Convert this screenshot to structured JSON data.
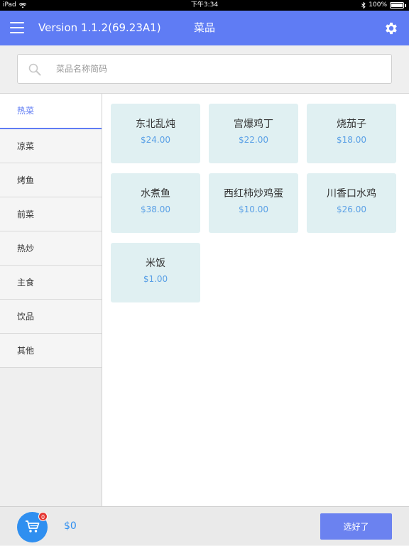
{
  "statusbar": {
    "device": "iPad",
    "time": "下午3:34",
    "battery": "100%"
  },
  "header": {
    "version": "Version 1.1.2(69.23A1)",
    "title": "菜品",
    "menu_icon": "hamburger-menu-icon",
    "settings_icon": "gear-icon"
  },
  "search": {
    "placeholder": "菜品名称简码",
    "value": ""
  },
  "categories": [
    {
      "label": "热菜",
      "active": true
    },
    {
      "label": "凉菜"
    },
    {
      "label": "烤鱼"
    },
    {
      "label": "前菜"
    },
    {
      "label": "热炒"
    },
    {
      "label": "主食"
    },
    {
      "label": "饮品"
    },
    {
      "label": "其他"
    }
  ],
  "dishes": [
    {
      "name": "东北乱炖",
      "price": "$24.00"
    },
    {
      "name": "宫爆鸡丁",
      "price": "$22.00"
    },
    {
      "name": "烧茄子",
      "price": "$18.00"
    },
    {
      "name": "水煮鱼",
      "price": "$38.00"
    },
    {
      "name": "西红柿炒鸡蛋",
      "price": "$10.00"
    },
    {
      "name": "川香口水鸡",
      "price": "$26.00"
    },
    {
      "name": "米饭",
      "price": "$1.00"
    }
  ],
  "cart": {
    "badge": "0",
    "total": "$0",
    "icon": "shopping-cart-icon"
  },
  "done_label": "选好了",
  "colors": {
    "accent": "#5f7cf4",
    "dish_bg": "#e0f0f2",
    "price": "#5aa0e6",
    "cart": "#2f8ff0",
    "badge": "#e53935"
  }
}
